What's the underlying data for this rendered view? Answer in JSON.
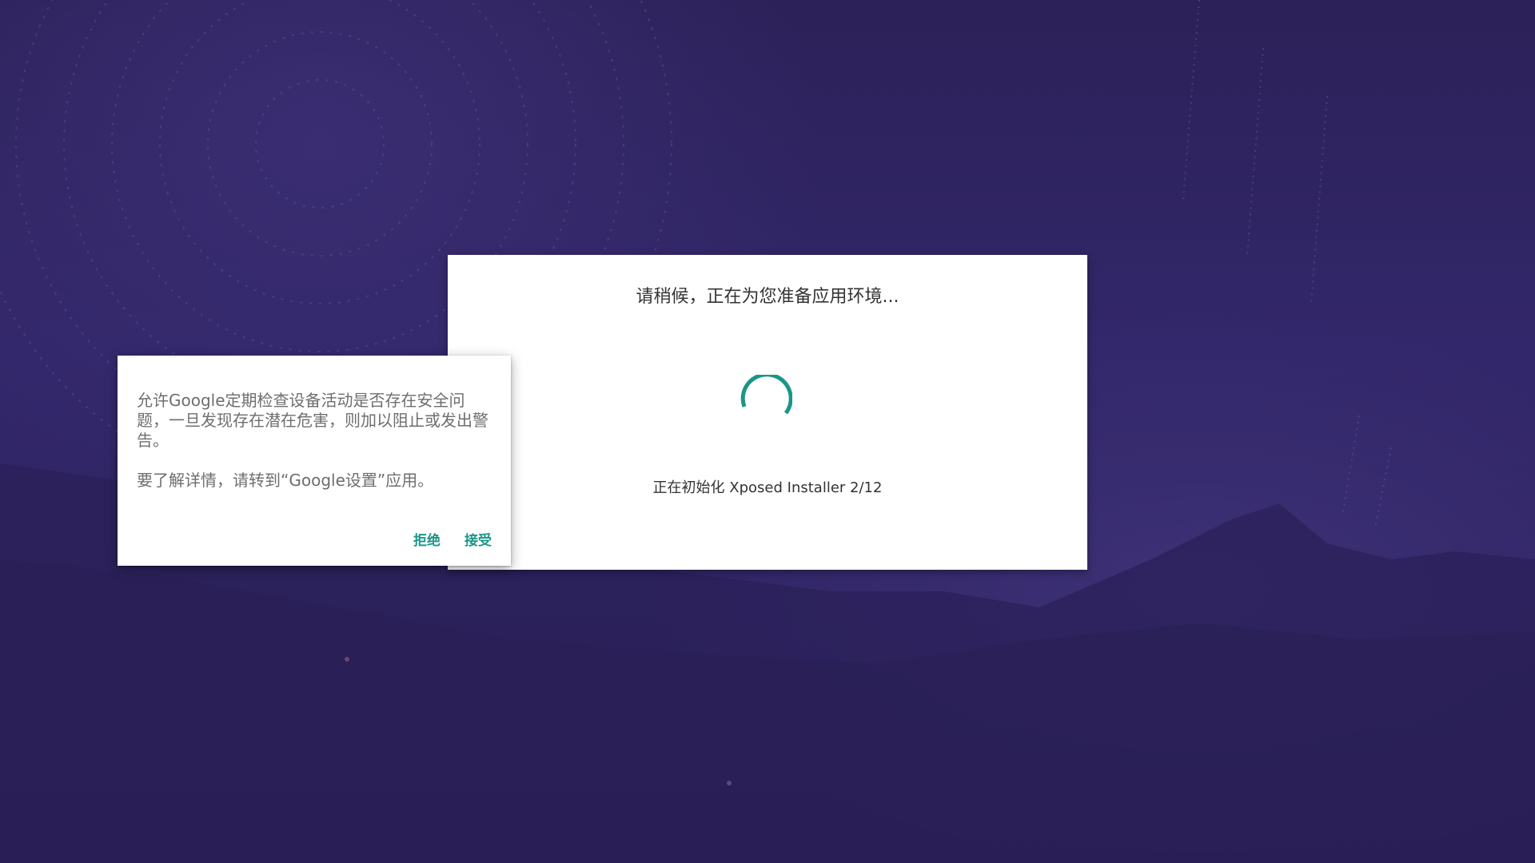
{
  "setup_dialog": {
    "title": "请稍候，正在为您准备应用环境...",
    "status": "正在初始化 Xposed Installer 2/12",
    "spinner_icon": "loading-spinner-icon"
  },
  "consent_dialog": {
    "message": "允许Google定期检查设备活动是否存在安全问题，一旦发现存在潜在危害，则加以阻止或发出警告。",
    "detail": "要了解详情，请转到“Google设置”应用。",
    "decline_label": "拒绝",
    "accept_label": "接受"
  },
  "colors": {
    "background": "#2e2260",
    "accent": "#1a9688",
    "dialog_bg": "#ffffff"
  }
}
